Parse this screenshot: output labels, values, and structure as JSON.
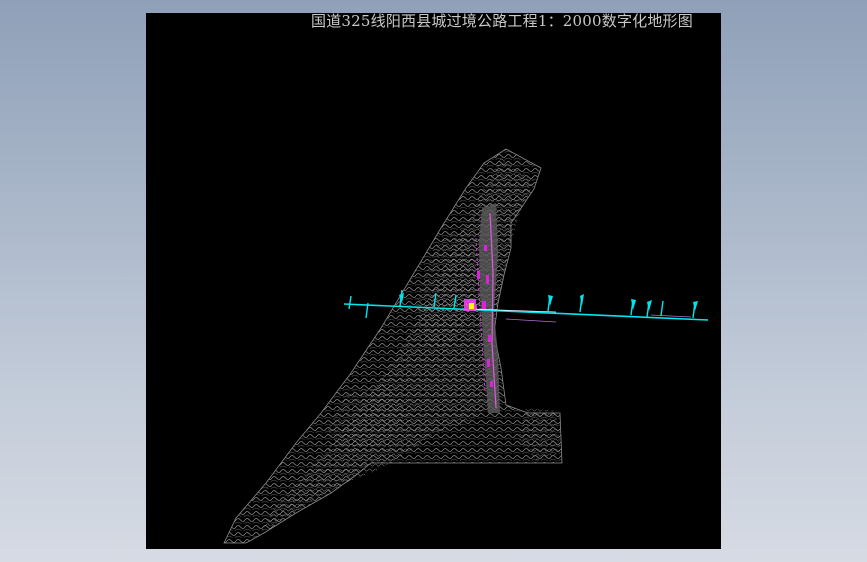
{
  "drawing": {
    "title": "国道325线阳西县城过境公路工程1：2000数字化地形图"
  },
  "colors": {
    "background": "#000000",
    "terrain": "#9a9a9a",
    "route_alignment": "#00e5ee",
    "road_features": "#e020e0",
    "grid_marks": "#ffffff",
    "title_text": "#c8c8c8"
  }
}
